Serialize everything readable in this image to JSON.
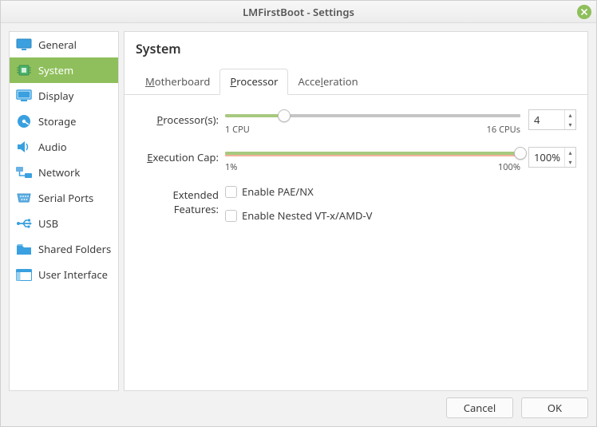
{
  "window": {
    "title": "LMFirstBoot - Settings"
  },
  "sidebar": {
    "items": [
      {
        "label": "General"
      },
      {
        "label": "System"
      },
      {
        "label": "Display"
      },
      {
        "label": "Storage"
      },
      {
        "label": "Audio"
      },
      {
        "label": "Network"
      },
      {
        "label": "Serial Ports"
      },
      {
        "label": "USB"
      },
      {
        "label": "Shared Folders"
      },
      {
        "label": "User Interface"
      }
    ],
    "active_index": 1
  },
  "panel": {
    "title": "System",
    "tabs": [
      {
        "label_pre": "",
        "label_u": "M",
        "label_post": "otherboard"
      },
      {
        "label_pre": "",
        "label_u": "P",
        "label_post": "rocessor"
      },
      {
        "label_pre": "Acce",
        "label_u": "l",
        "label_post": "eration"
      }
    ],
    "active_tab": 1
  },
  "processor": {
    "processors_label_pre": "",
    "processors_label_u": "P",
    "processors_label_post": "rocessor(s):",
    "processors_min_label": "1 CPU",
    "processors_max_label": "16 CPUs",
    "processors_value": "4",
    "processors_min": 1,
    "processors_max": 16,
    "processors_green_end_pct": 49,
    "processors_orange_end_pct": 100,
    "processors_thumb_pct": 20,
    "execcap_label_pre": "",
    "execcap_label_u": "E",
    "execcap_label_post": "xecution Cap:",
    "execcap_min_label": "1%",
    "execcap_max_label": "100%",
    "execcap_value": "100%",
    "execcap_green_end_pct": 100,
    "execcap_orange_start_pct": 0,
    "execcap_orange_end_pct": 100,
    "execcap_thumb_pct": 100,
    "ext_label": "Extended Features:",
    "pae_label_pre": "Enable PA",
    "pae_label_u": "E",
    "pae_label_post": "/NX",
    "pae_checked": false,
    "nested_label_pre": "Enable Nested ",
    "nested_label_u": "V",
    "nested_label_post": "T-x/AMD-V",
    "nested_checked": false
  },
  "buttons": {
    "cancel": "Cancel",
    "ok": "OK"
  }
}
